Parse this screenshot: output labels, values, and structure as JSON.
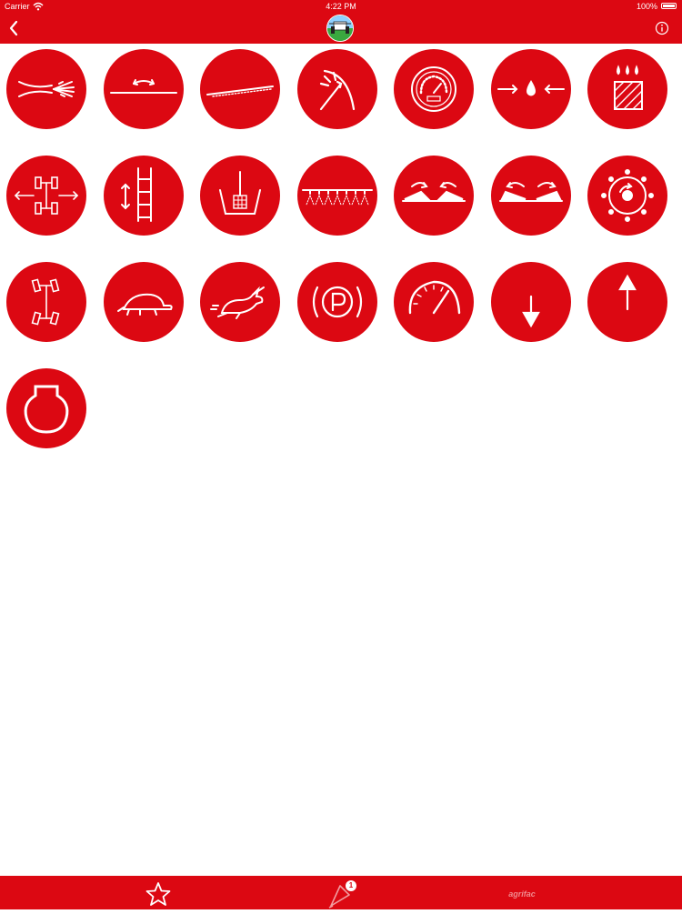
{
  "status_bar": {
    "carrier": "Carrier",
    "time": "4:22 PM",
    "battery": "100%",
    "wifi_icon": "wifi-icon",
    "battery_icon": "battery-icon"
  },
  "nav_bar": {
    "back_icon": "chevron-left-icon",
    "logo_icon": "tractor-logo-icon",
    "info_icon": "info-icon"
  },
  "colors": {
    "accent": "#dc0812",
    "on_accent": "#ffffff",
    "background": "#ffffff",
    "logo_green": "#2d9e3a"
  },
  "symbols": [
    "spray-nozzle-icon",
    "boom-level-icon",
    "boom-tilt-icon",
    "pressure-arc-icon",
    "pressure-gauge-icon",
    "liquid-pressure-icon",
    "tank-fill-icon",
    "track-width-icon",
    "ladder-icon",
    "filter-basket-icon",
    "boom-sections-icon",
    "boom-fold-in-icon",
    "boom-fold-out-icon",
    "rotation-dial-icon",
    "four-wheel-steer-icon",
    "tortoise-icon",
    "hare-icon",
    "parking-brake-icon",
    "speedometer-icon",
    "arrow-down-icon",
    "arrow-up-icon",
    "tank-outline-icon"
  ],
  "tab_bar": {
    "favorites_icon": "star-icon",
    "alerts_icon": "megaphone-icon",
    "alerts_badge": "1",
    "brand_label": "agrifac"
  }
}
